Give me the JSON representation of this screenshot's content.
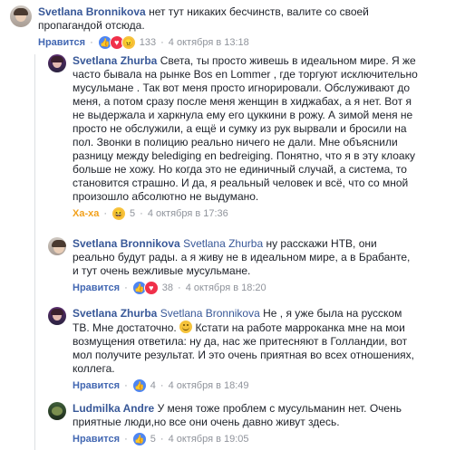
{
  "comments": [
    {
      "author": "Svetlana Bronnikova",
      "mention": "",
      "text_lines": [
        "нет тут никаких бесчинств, валите со своей",
        "пропагандой отсюда."
      ],
      "action": "Нравится",
      "reactions": [
        "like",
        "love",
        "angry"
      ],
      "count": "133",
      "time": "4 октября в 13:18"
    },
    {
      "author": "Svetlana Zhurba",
      "mention": "",
      "text_lines": [
        "Света, ты просто живешь в идеальном мире. Я же",
        "часто бывала на рынке Bos en Lommer , где торгуют исключительно",
        "мусульмане . Так вот меня просто игнорировали. Обслуживают до",
        "меня, а потом сразу после меня женщин в хиджабах, а я нет. Вот я",
        "не выдержала и харкнула ему его цуккини в рожу. А зимой меня не",
        "просто не обслужили, а ещё и сумку из рук вырвали и бросили на",
        "пол. Звонки в полицию реально ничего не дали. Мне объяснили",
        "разницу между belediging en bedreiging. Понятно, что я в эту клоаку",
        "больше не хожу. Но когда это не единичный случай, а система, то",
        "становится страшно. И да, я реальный человек и всё, что со мной",
        "произошло абсолютно не выдумано."
      ],
      "action": "Ха-ха",
      "reactions": [
        "haha"
      ],
      "count": "5",
      "time": "4 октября в 17:36"
    },
    {
      "author": "Svetlana Bronnikova",
      "mention": "Svetlana Zhurba",
      "text_lines": [
        "ну расскажи НТВ, они",
        "реально будут рады. а я живу не в идеальном мире, а в Брабанте,",
        "и тут очень вежливые мусульмане."
      ],
      "action": "Нравится",
      "reactions": [
        "like",
        "love"
      ],
      "count": "38",
      "time": "4 октября в 18:20"
    },
    {
      "author": "Svetlana Zhurba",
      "mention": "Svetlana Bronnikova",
      "text_lines": [
        "Не , я уже была на русском",
        "ТВ. Мне достаточно.",
        "Кстати на работе марроканка мне на мои",
        "возмущения ответила: ну да, нас же притесняют в Голландии, вот",
        "мол получите результат. И это очень приятная во всех отношениях,",
        "коллега."
      ],
      "action": "Нравится",
      "reactions": [
        "like"
      ],
      "count": "4",
      "time": "4 октября в 18:49"
    },
    {
      "author": "Ludmilka Andre",
      "mention": "",
      "text_lines": [
        "У меня тоже проблем с мусульманин нет. Очень",
        "приятные люди,но все они очень давно живут здесь."
      ],
      "action": "Нравится",
      "reactions": [
        "like"
      ],
      "count": "5",
      "time": "4 октября в 19:05"
    }
  ],
  "reaction_glyphs": {
    "like": "👍",
    "love": "♥",
    "haha": "😆",
    "angry": "😠"
  },
  "colors": {
    "author": "#385898",
    "meta": "#90949c",
    "like": "#4267b2",
    "haha": "#f2a11c"
  }
}
